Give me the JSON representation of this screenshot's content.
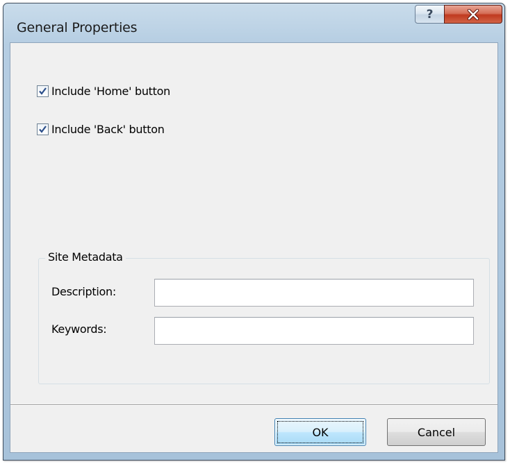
{
  "window": {
    "title": "General Properties",
    "help_label": "?",
    "close_icon": "close-x-icon"
  },
  "options": [
    {
      "label": "Include 'Home' button",
      "checked": true
    },
    {
      "label": "Include 'Back' button",
      "checked": true
    }
  ],
  "site_metadata": {
    "legend": "Site Metadata",
    "description_label": "Description:",
    "description_value": "",
    "keywords_label": "Keywords:",
    "keywords_value": ""
  },
  "buttons": {
    "ok_label": "OK",
    "cancel_label": "Cancel"
  },
  "colors": {
    "close_button": "#c0391f",
    "check_mark": "#2b4e8a",
    "default_button_border": "#3c7fb1"
  }
}
